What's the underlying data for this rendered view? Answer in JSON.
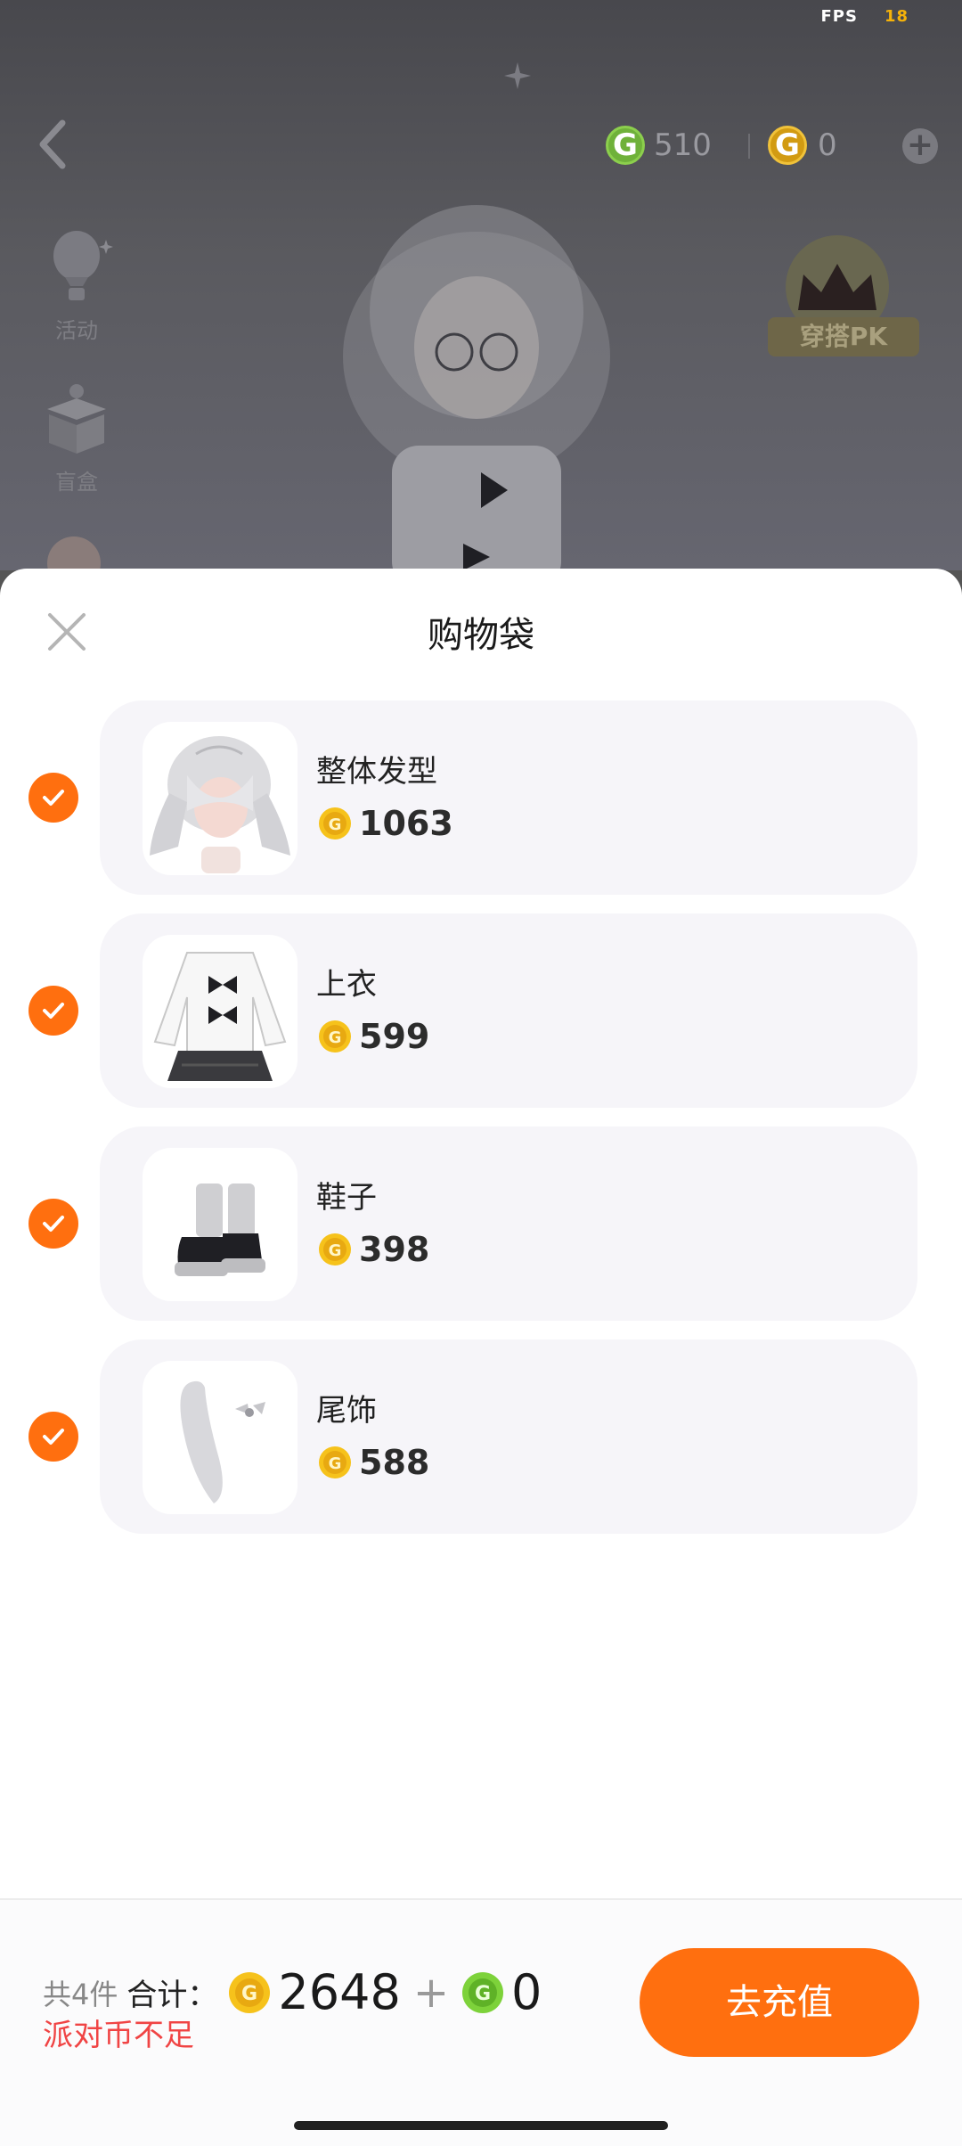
{
  "status": {
    "fps_label": "FPS",
    "fps_value": "18"
  },
  "header": {
    "green_coin_amount": "510",
    "gold_coin_amount": "0"
  },
  "sidebar": {
    "items": [
      {
        "label": "活动"
      },
      {
        "label": "盲盒"
      }
    ]
  },
  "pk_badge": {
    "label": "穿搭PK"
  },
  "sheet": {
    "title": "购物袋",
    "items": [
      {
        "name": "整体发型",
        "price": "1063",
        "checked": true
      },
      {
        "name": "上衣",
        "price": "599",
        "checked": true
      },
      {
        "name": "鞋子",
        "price": "398",
        "checked": true
      },
      {
        "name": "尾饰",
        "price": "588",
        "checked": true
      }
    ]
  },
  "footer": {
    "count_text": "共4件",
    "total_label": "合计：",
    "gold_total": "2648",
    "plus": "+",
    "green_total": "0",
    "warning": "派对币不足",
    "recharge_label": "去充值"
  },
  "colors": {
    "accent": "#ff6f0f",
    "warning": "#f04444",
    "card_bg": "#f6f5f9"
  }
}
